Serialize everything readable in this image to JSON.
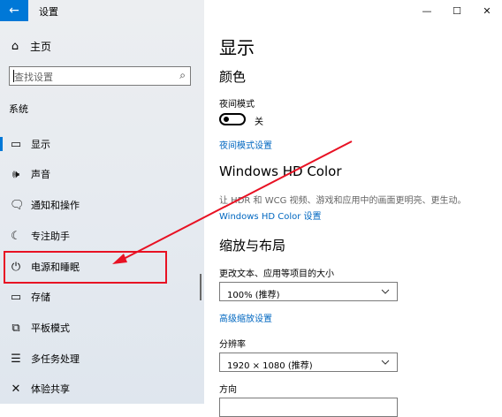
{
  "titlebar": {
    "back_glyph": "←",
    "app_title": "设置"
  },
  "window_controls": {
    "minimize": "—",
    "maximize": "☐",
    "close": "✕"
  },
  "sidebar": {
    "home": {
      "icon": "⌂",
      "label": "主页"
    },
    "search": {
      "placeholder": "查找设置",
      "icon": "⌕"
    },
    "section_label": "系统",
    "items": [
      {
        "icon": "▭",
        "label": "显示",
        "active": true
      },
      {
        "icon": "🕪",
        "label": "声音"
      },
      {
        "icon": "🗨",
        "label": "通知和操作"
      },
      {
        "icon": "☾",
        "label": "专注助手"
      },
      {
        "icon": "⏻",
        "label": "电源和睡眠"
      },
      {
        "icon": "▭",
        "label": "存储"
      },
      {
        "icon": "⧉",
        "label": "平板模式"
      },
      {
        "icon": "☰",
        "label": "多任务处理"
      },
      {
        "icon": "✕",
        "label": "体验共享"
      }
    ]
  },
  "main": {
    "title": "显示",
    "color_section": {
      "title": "颜色",
      "night_light_label": "夜间模式",
      "night_light_state": "关",
      "night_light_settings_link": "夜间模式设置"
    },
    "hd_color_section": {
      "title": "Windows HD Color",
      "description": "让 HDR 和 WCG 视频、游戏和应用中的画面更明亮、更生动。",
      "link": "Windows HD Color 设置"
    },
    "scale_section": {
      "title": "缩放与布局",
      "scale_label": "更改文本、应用等项目的大小",
      "scale_value": "100% (推荐)",
      "advanced_link": "高级缩放设置",
      "resolution_label": "分辨率",
      "resolution_value": "1920 × 1080 (推荐)",
      "orientation_label": "方向"
    }
  },
  "colors": {
    "accent": "#0078d7",
    "highlight_red": "#e81123",
    "link": "#0067c0"
  }
}
